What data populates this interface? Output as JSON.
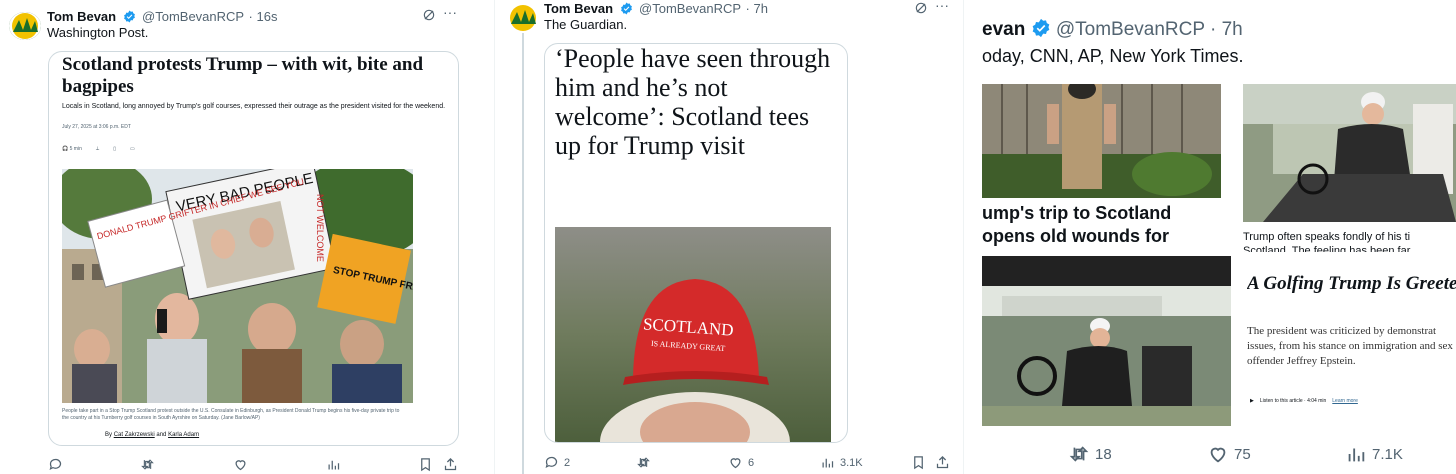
{
  "tweets": [
    {
      "author": "Tom Bevan",
      "handle": "@TomBevanRCP",
      "time": "· 16s",
      "text": "Washington Post.",
      "article": {
        "headline": "Scotland protests Trump – with wit, bite and bagpipes",
        "dek": "Locals in Scotland, long annoyed by Trump's golf courses, expressed their outrage as the president visited for the weekend.",
        "date": "July 27, 2025 at 3:06 p.m. EDT",
        "listen": "5 min",
        "signs": {
          "sign1": "VERY BAD PEOPLE",
          "sign2": "NOT WELCOME",
          "sign3": "STOP TRUMP FREE GAZA",
          "sign4": "DONALD TRUMP GRIFTER IN CHIEF WE SEE YOU"
        },
        "caption": "People take part in a Stop Trump Scotland protest outside the U.S. Consulate in Edinburgh, as President Donald Trump begins his five-day private trip to the country at his Turnberry golf courses in South Ayrshire on Saturday. (Jane Barlow/AP)",
        "byline_prefix": "By",
        "author1": "Cat Zakrzewski",
        "and": "and",
        "author2": "Karla Adam"
      },
      "actions": {
        "replies": "",
        "reposts": "",
        "likes": "",
        "views": ""
      }
    },
    {
      "author": "Tom Bevan",
      "handle": "@TomBevanRCP",
      "time": "· 7h",
      "text": "The Guardian.",
      "article": {
        "headline": "‘People have seen through him and he’s not welcome’: Scotland tees up for Trump visit",
        "hat_line1": "SCOTLAND",
        "hat_line2": "IS ALREADY GREAT"
      },
      "actions": {
        "replies": "2",
        "reposts": "",
        "likes": "6",
        "views": "3.1K"
      }
    },
    {
      "author": "evan",
      "handle": "@TomBevanRCP",
      "time": "· 7h",
      "text": "oday, CNN, AP, New York Times.",
      "cnn_headline_1": "ump's trip to Scotland",
      "cnn_headline_2": "opens old wounds for",
      "ap_caption_1": "Trump often speaks fondly of his ti",
      "ap_caption_2": "Scotland. The feeling has been far",
      "nyt_headline": "A Golfing Trump Is Greete Protesters in Scotland",
      "nyt_dek": "The president was criticized by demonstrat issues, from his stance on immigration and sex offender Jeffrey Epstein.",
      "nyt_listen": "Listen to this article · 4:04 min",
      "nyt_learn": "Learn more",
      "actions": {
        "reposts": "18",
        "likes": "75",
        "views": "7.1K"
      }
    }
  ],
  "colors": {
    "verified": "#1d9bf0",
    "muted": "#536471",
    "border": "#cfd9de",
    "hat": "#d42a2a"
  }
}
